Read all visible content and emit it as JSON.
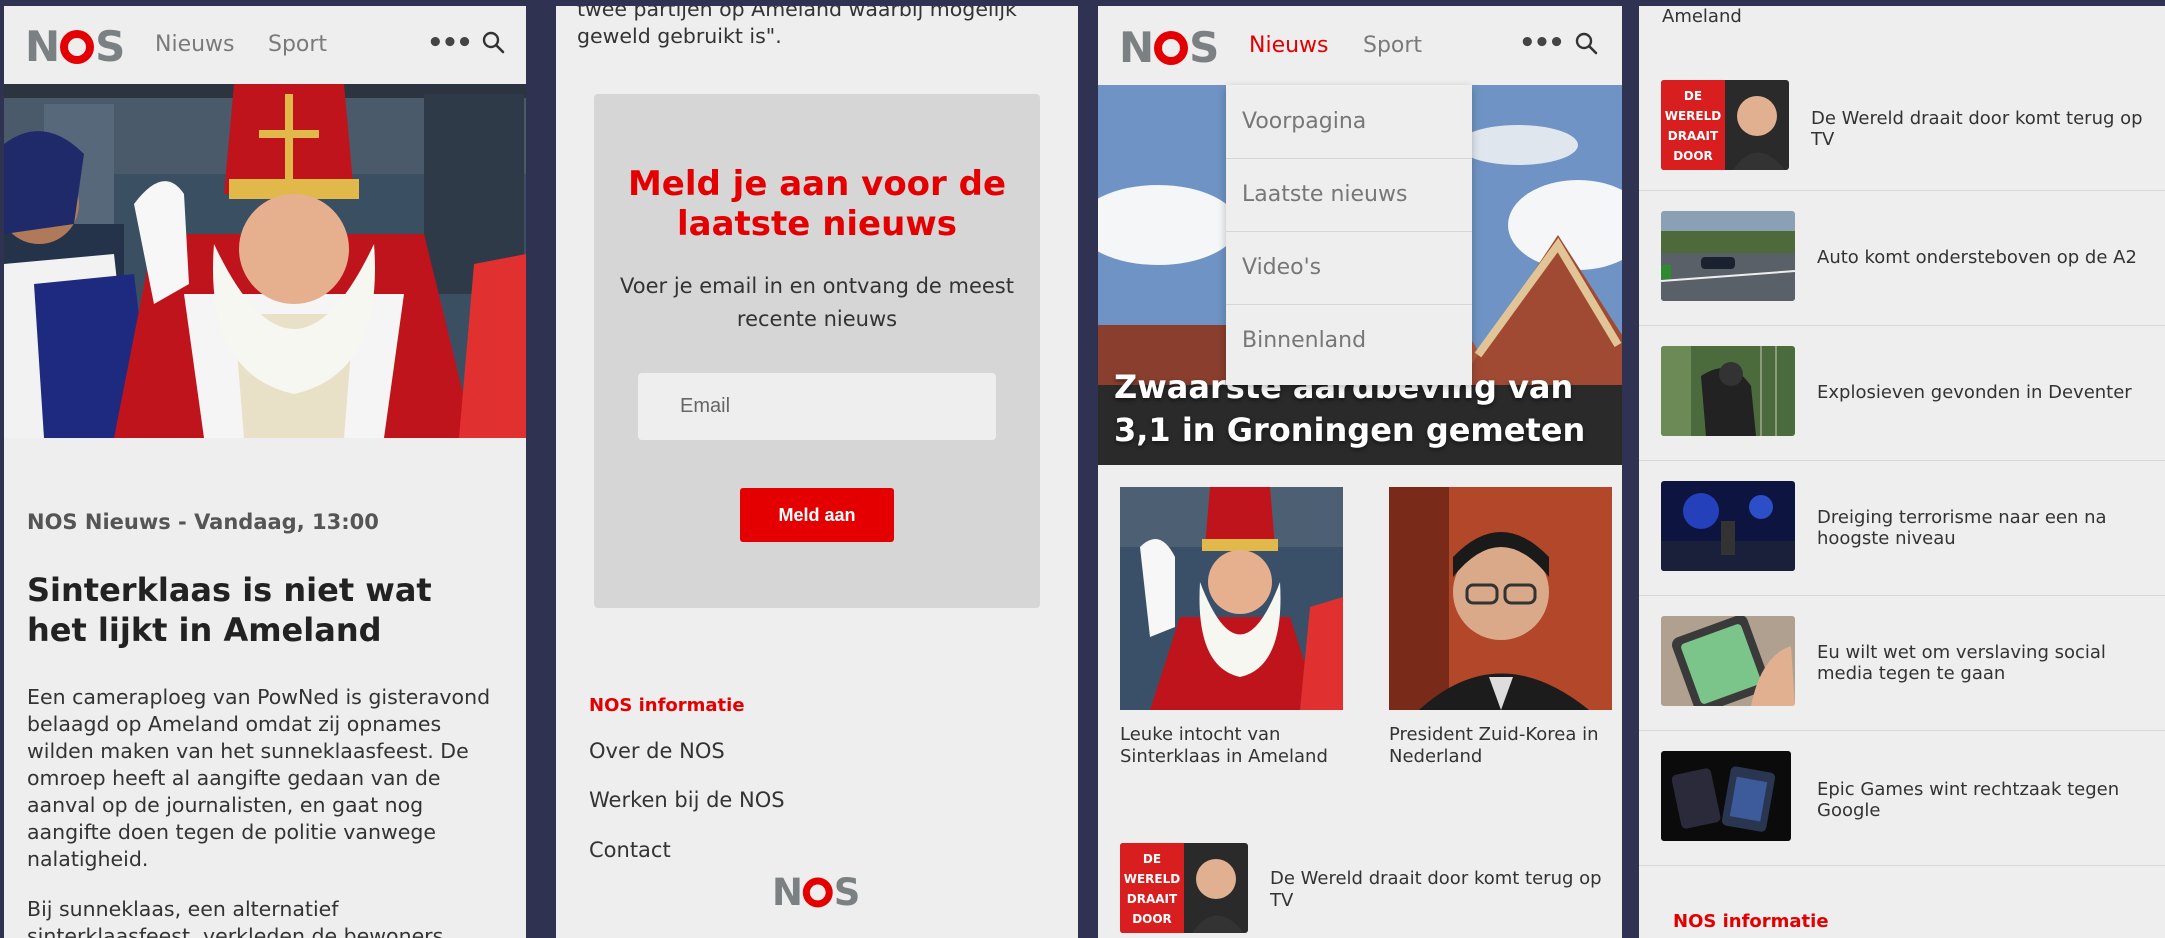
{
  "header": {
    "logo": "NOS",
    "nav_news": "Nieuws",
    "nav_sport": "Sport",
    "more_glyph": "•••",
    "search_icon": "search-icon"
  },
  "article": {
    "meta": "NOS Nieuws - Vandaag, 13:00",
    "title": "Sinterklaas is niet wat het lijkt in Ameland",
    "paragraph1": "Een cameraploeg van PowNed is gisteravond belaagd op Ameland omdat zij opnames wilden maken van het sunneklaasfeest. De omroep heeft al aangifte gedaan van de aanval op de journalisten, en gaat nog aangifte doen tegen de politie vanwege nalatigheid.",
    "paragraph2": "Bij sunneklaas, een alternatief sinterklaasfeest, verkleden de bewoners",
    "quote_tail": "twee partijen op Ameland waarbij mogelijk geweld gebruikt is\"."
  },
  "newsletter": {
    "title": "Meld je aan voor de laatste nieuws",
    "subtitle": "Voer je email in en ontvang de meest recente nieuws",
    "email_placeholder": "Email",
    "submit_label": "Meld aan"
  },
  "footer": {
    "heading": "NOS informatie",
    "links": [
      "Over de NOS",
      "Werken bij de NOS",
      "Contact"
    ],
    "logo": "NOS"
  },
  "menu": {
    "items": [
      "Voorpagina",
      "Laatste nieuws",
      "Video's",
      "Binnenland"
    ]
  },
  "home": {
    "hero_title": "Zwaarste aardbeving van 3,1 in Groningen gemeten",
    "cards": [
      {
        "caption": "Leuke intocht van Sinterklaas in Ameland"
      },
      {
        "caption": "President Zuid-Korea in Nederland"
      }
    ],
    "row_caption": "De Wereld draait door komt terug op TV",
    "thumb_text": [
      "DE",
      "WERELD",
      "DRAAIT",
      "DOOR"
    ]
  },
  "list": {
    "top_fragment": "Ameland",
    "items": [
      "De Wereld draait door komt terug op TV",
      "Auto komt ondersteboven op de A2",
      "Explosieven gevonden in Deventer",
      "Dreiging terrorisme naar een na hoogste niveau",
      "Eu wilt wet om verslaving social media tegen te gaan",
      "Epic Games wint rechtzaak tegen Google"
    ],
    "footer_heading": "NOS informatie"
  },
  "colors": {
    "brand_red": "#e40000",
    "logo_grey": "#7b8183",
    "panel_bg": "#eeeeee",
    "page_bg": "#2f3250"
  }
}
